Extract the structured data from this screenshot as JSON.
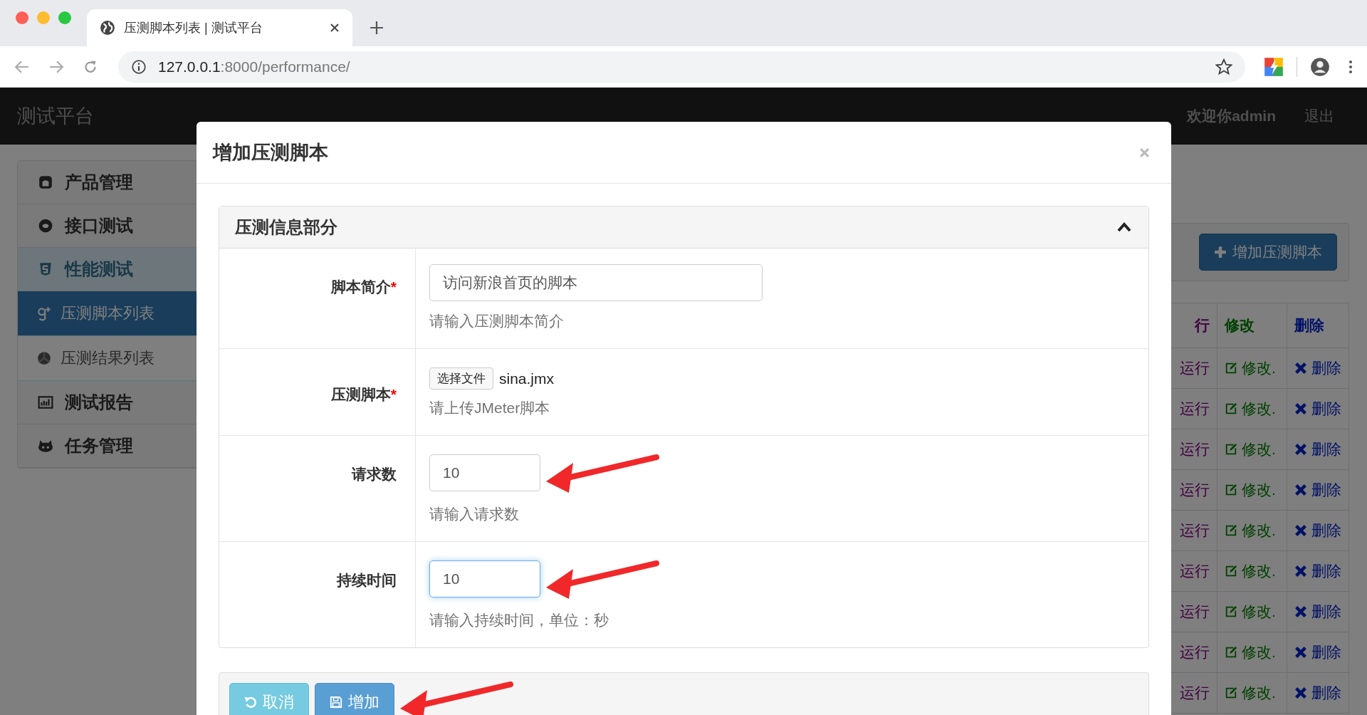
{
  "browser": {
    "tab_title": "压测脚本列表 | 测试平台",
    "url_host": "127.0.0.1",
    "url_rest": ":8000/performance/"
  },
  "app": {
    "brand": "测试平台",
    "welcome": "欢迎你admin",
    "logout": "退出"
  },
  "sidebar": {
    "items": [
      {
        "label": "产品管理",
        "expanded": false
      },
      {
        "label": "接口测试",
        "expanded": false
      },
      {
        "label": "性能测试",
        "expanded": true,
        "children": [
          {
            "label": "压测脚本列表",
            "selected": true
          },
          {
            "label": "压测结果列表",
            "selected": false
          }
        ]
      },
      {
        "label": "测试报告",
        "expanded": false
      },
      {
        "label": "任务管理",
        "expanded": false
      }
    ]
  },
  "page": {
    "add_button": "增加压测脚本",
    "table": {
      "columns": [
        "行",
        "修改",
        "删除"
      ],
      "rows": [
        [
          "运行",
          "修改.",
          "删除"
        ],
        [
          "运行",
          "修改.",
          "删除"
        ],
        [
          "运行",
          "修改.",
          "删除"
        ],
        [
          "运行",
          "修改.",
          "删除"
        ],
        [
          "运行",
          "修改.",
          "删除"
        ],
        [
          "运行",
          "修改.",
          "删除"
        ],
        [
          "运行",
          "修改.",
          "删除"
        ],
        [
          "运行",
          "修改.",
          "删除"
        ],
        [
          "运行",
          "修改.",
          "删除"
        ]
      ]
    }
  },
  "modal": {
    "title": "增加压测脚本",
    "panel": {
      "title": "压测信息部分",
      "expanded": true,
      "fields": [
        {
          "kind": "text",
          "label": "脚本简介",
          "required_mark": "*",
          "value": "访问新浪首页的脚本",
          "help": "请输入压测脚本简介",
          "focused": false,
          "arrow": false
        },
        {
          "kind": "file",
          "label": "压测脚本",
          "required_mark": "*",
          "button": "选择文件",
          "value": "sina.jmx",
          "help": "请上传JMeter脚本",
          "arrow": false
        },
        {
          "kind": "number",
          "label": "请求数",
          "value": "10",
          "help": "请输入请求数",
          "focused": false,
          "arrow": true
        },
        {
          "kind": "number",
          "label": "持续时间",
          "value": "10",
          "help": "请输入持续时间，单位：秒",
          "focused": true,
          "arrow": true
        }
      ]
    },
    "buttons": [
      {
        "kind": "cancel",
        "label": "取消",
        "arrow": false
      },
      {
        "kind": "submit",
        "label": "增加",
        "arrow": true
      }
    ]
  }
}
